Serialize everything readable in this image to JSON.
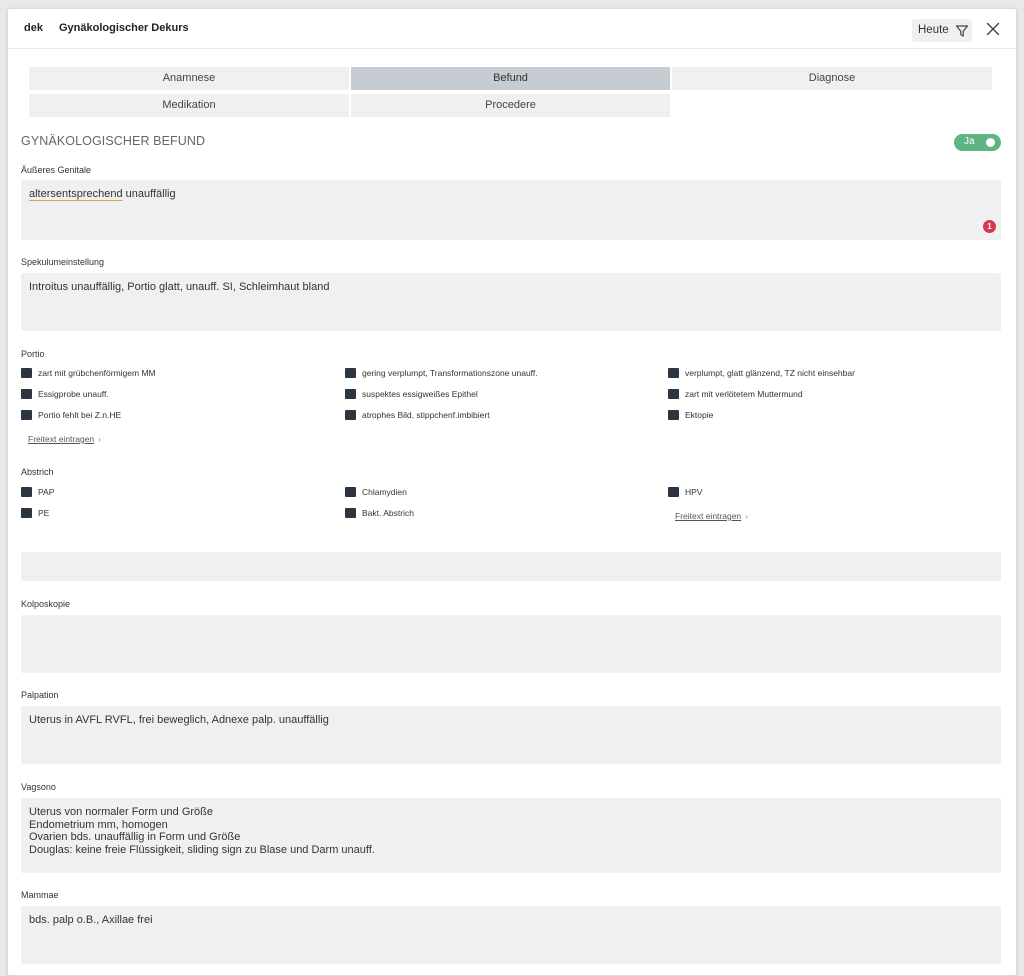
{
  "header": {
    "code": "dek",
    "title": "Gynäkologischer Dekurs",
    "today_label": "Heute"
  },
  "tabs": [
    {
      "label": "Anamnese",
      "active": false
    },
    {
      "label": "Befund",
      "active": true
    },
    {
      "label": "Diagnose",
      "active": false
    },
    {
      "label": "Medikation",
      "active": false
    },
    {
      "label": "Procedere",
      "active": false
    }
  ],
  "section": {
    "title": "GYNÄKOLOGISCHER BEFUND",
    "toggle_label": "Ja",
    "toggle_on": true
  },
  "fields": {
    "aeusseres_genitale": {
      "label": "Äußeres Genitale",
      "value_misspelled": "altersentsprechend",
      "value_rest": " unauffällig",
      "badge": "1"
    },
    "spekulum": {
      "label": "Spekulumeinstellung",
      "value": "Introitus unauffällig, Portio glatt, unauff. SI, Schleimhaut bland"
    },
    "abstrich_text": {
      "value": ""
    },
    "kolposkopie": {
      "label": "Kolposkopie",
      "value": ""
    },
    "palpation": {
      "label": "Palpation",
      "value": "Uterus in AVFL RVFL, frei beweglich, Adnexe palp. unauffällig"
    },
    "vagsono": {
      "label": "Vagsono",
      "value": "Uterus von normaler Form und Größe\nEndometrium mm, homogen\nOvarien bds. unauffällig in Form und Größe\nDouglas: keine freie Flüssigkeit, sliding sign zu Blase und Darm unauff."
    },
    "mammae": {
      "label": "Mammae",
      "value": "bds. palp o.B., Axillae frei"
    }
  },
  "portio": {
    "label": "Portio",
    "options": [
      "zart mit grübchenförmigem MM",
      "gering verplumpt, Transformationszone unauff.",
      "verplumpt, glatt glänzend, TZ nicht einsehbar",
      "Essigprobe unauff.",
      "suspektes essigweißes Epithel",
      "zart mit verlötetem Muttermund",
      "Portio fehlt bei Z.n.HE",
      "atrophes Bild, stippchenf.imbibiert",
      "Ektopie"
    ],
    "freetext_link": "Freitext eintragen"
  },
  "abstrich": {
    "label": "Abstrich",
    "options": [
      "PAP",
      "Chlamydien",
      "HPV",
      "PE",
      "Bakt. Abstrich"
    ],
    "freetext_link": "Freitext eintragen"
  },
  "colors": {
    "tab_bg": "#eef0f2",
    "tab_active_bg": "#c6ccd4",
    "field_bg": "#eef0f2",
    "toggle_green": "#5fb483",
    "badge_red": "#d93950",
    "checkbox_dark": "#2d3540",
    "spell_underline": "#e8a33a"
  }
}
